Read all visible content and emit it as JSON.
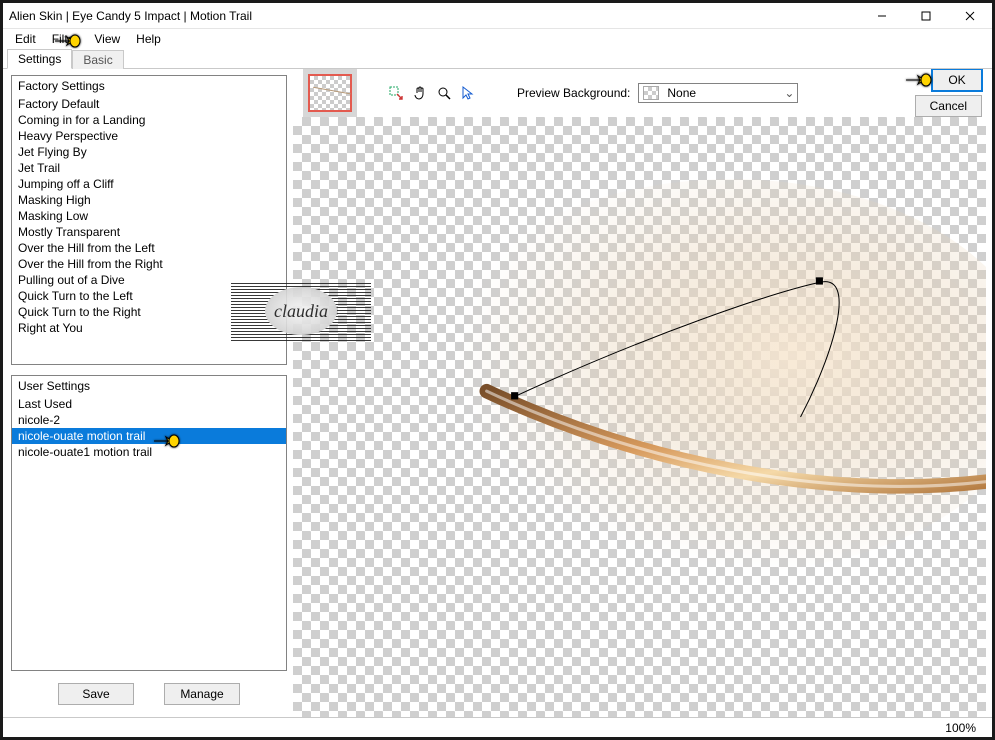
{
  "window": {
    "title": "Alien Skin | Eye Candy 5 Impact | Motion Trail"
  },
  "menu": {
    "items": [
      "Edit",
      "Filter",
      "View",
      "Help"
    ]
  },
  "tabs": {
    "items": [
      "Settings",
      "Basic"
    ],
    "active": 0
  },
  "factory_settings": {
    "header": "Factory Settings",
    "items": [
      "Factory Default",
      "Coming in for a Landing",
      "Heavy Perspective",
      "Jet Flying By",
      "Jet Trail",
      "Jumping off a Cliff",
      "Masking High",
      "Masking Low",
      "Mostly Transparent",
      "Over the Hill from the Left",
      "Over the Hill from the Right",
      "Pulling out of a Dive",
      "Quick Turn to the Left",
      "Quick Turn to the Right",
      "Right at You"
    ]
  },
  "user_settings": {
    "header": "User Settings",
    "items": [
      "Last Used",
      "nicole-2",
      "nicole-ouate motion trail",
      "nicole-ouate1 motion trail"
    ],
    "selected_index": 2
  },
  "left_buttons": {
    "save": "Save",
    "manage": "Manage"
  },
  "preview": {
    "label": "Preview Background:",
    "value": "None"
  },
  "dialog_buttons": {
    "ok": "OK",
    "cancel": "Cancel"
  },
  "status": {
    "zoom": "100%"
  },
  "icons": {
    "selection_tool": "selection-tool",
    "hand_tool": "hand-tool",
    "zoom_tool": "zoom-tool",
    "pointer_tool": "pointer-tool"
  },
  "watermark": {
    "text": "claudia"
  }
}
